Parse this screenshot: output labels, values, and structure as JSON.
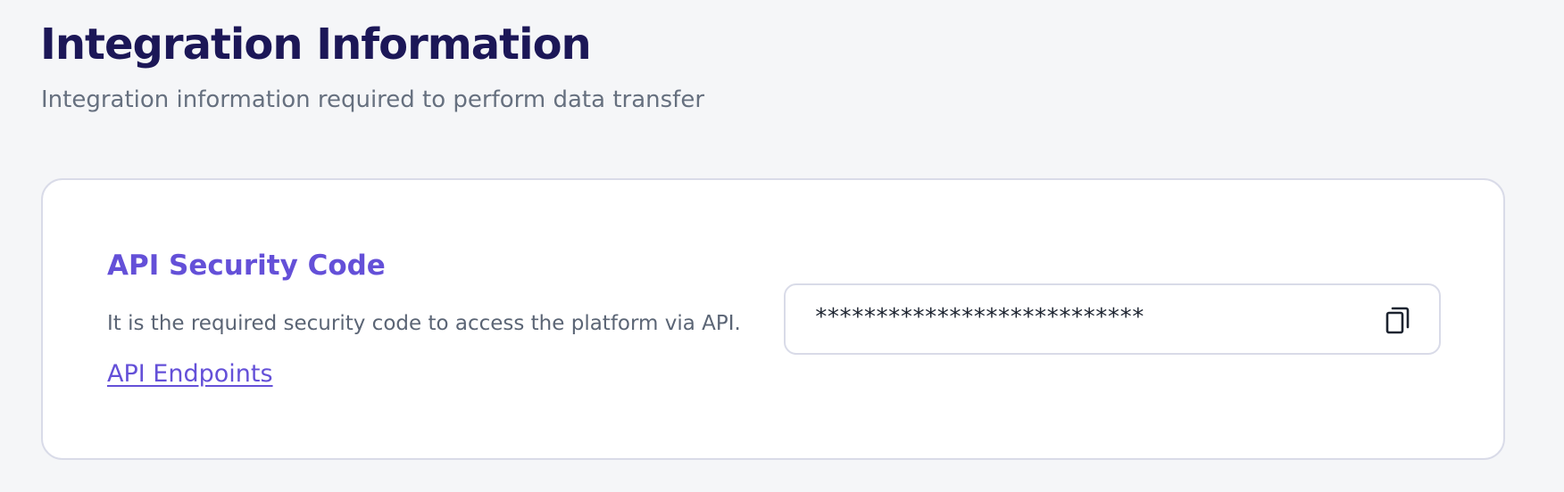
{
  "header": {
    "title": "Integration Information",
    "subtitle": "Integration information required to perform data transfer"
  },
  "api_section": {
    "title": "API Security Code",
    "description": "It is the required security code to access the platform via API.",
    "endpoints_link": "API Endpoints",
    "code_value": "***************************",
    "copy_icon": "copy-icon"
  },
  "colors": {
    "title": "#1c1757",
    "accent": "#6450d8",
    "subtitle": "#66707f",
    "border": "#d9dbe8",
    "background": "#f5f6f8"
  }
}
